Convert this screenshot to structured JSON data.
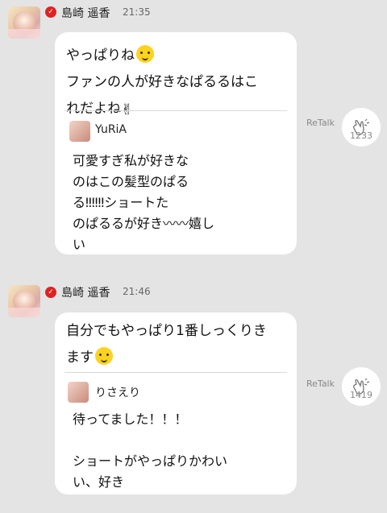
{
  "colors": {
    "background": "#e4e4e4",
    "bubble": "#ffffff",
    "badge": "#dd2222"
  },
  "posts": [
    {
      "author": "島崎 遥香",
      "time": "21:35",
      "message": "やっぱりね",
      "message_line2": "ファンの人が好きなぱるるはこ",
      "message_line3": "れだよね",
      "quote": {
        "author": "YuRiA",
        "text": "可愛すぎ私が好きな\nのはこの髪型のぱる\nる‼‼‼ショートた\nのぱるるが好き〰〰嬉し\nい"
      },
      "retalk_label": "ReTalk",
      "clap_count": "1233"
    },
    {
      "author": "島崎 遥香",
      "time": "21:46",
      "message": "自分でもやっぱり1番しっくりき",
      "message_line2": "ます",
      "quote": {
        "author": "りさえり",
        "text": "待ってました！！！\n\nショートがやっぱりかわい\nい、好き"
      },
      "retalk_label": "ReTalk",
      "clap_count": "1419"
    }
  ]
}
